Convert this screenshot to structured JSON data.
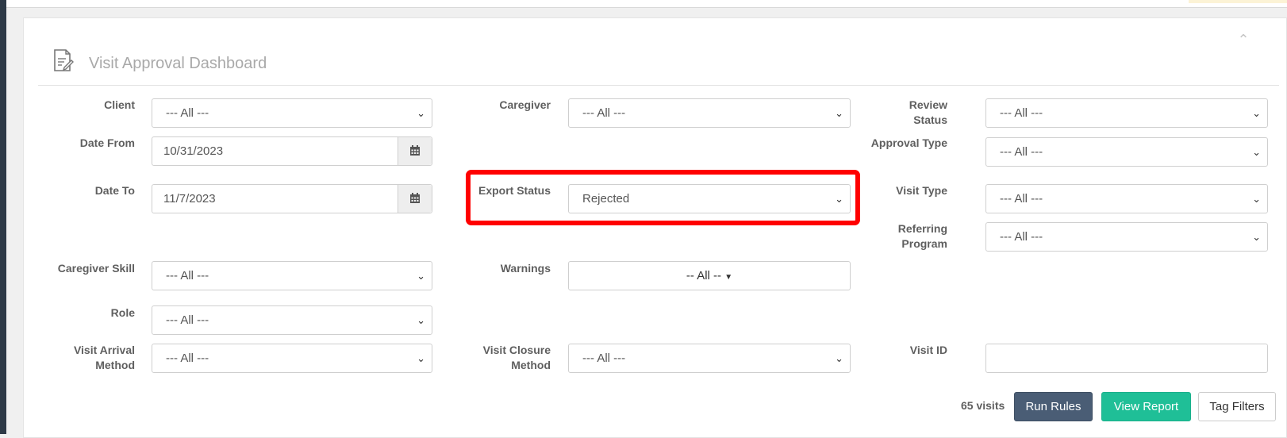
{
  "dashboard": {
    "title": "Visit Approval Dashboard",
    "collapse_icon": "chevron-up-icon",
    "title_icon": "document-edit-icon"
  },
  "filters": {
    "client": {
      "label": "Client",
      "value": "--- All ---"
    },
    "caregiver": {
      "label": "Caregiver",
      "value": "--- All ---"
    },
    "review_status": {
      "label": "Review Status",
      "value": "--- All ---"
    },
    "date_from": {
      "label": "Date From",
      "value": "10/31/2023"
    },
    "approval_type": {
      "label": "Approval Type",
      "value": "--- All ---"
    },
    "date_to": {
      "label": "Date To",
      "value": "11/7/2023"
    },
    "export_status": {
      "label": "Export Status",
      "value": "Rejected"
    },
    "visit_type": {
      "label": "Visit Type",
      "value": "--- All ---"
    },
    "referring_program": {
      "label_line1": "Referring",
      "label_line2": "Program",
      "value": "--- All ---"
    },
    "caregiver_skill": {
      "label": "Caregiver Skill",
      "value": "--- All ---"
    },
    "warnings": {
      "label": "Warnings",
      "value": "-- All --"
    },
    "role": {
      "label": "Role",
      "value": "--- All ---"
    },
    "visit_arrival_method": {
      "label_line1": "Visit Arrival",
      "label_line2": "Method",
      "value": "--- All ---"
    },
    "visit_closure_method": {
      "label_line1": "Visit Closure",
      "label_line2": "Method",
      "value": "--- All ---"
    },
    "visit_id": {
      "label": "Visit ID",
      "value": ""
    }
  },
  "footer": {
    "visit_count": "65 visits",
    "run_rules": "Run Rules",
    "view_report": "View Report",
    "tag_filters": "Tag Filters"
  },
  "colors": {
    "highlight": "#ff0000",
    "run_rules_bg": "#4a5d75",
    "view_report_bg": "#1fbf97"
  }
}
